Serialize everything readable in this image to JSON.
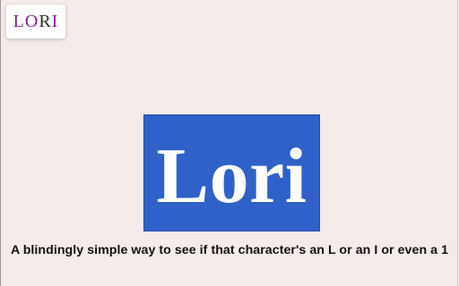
{
  "header": {
    "logo_text_part1": "LO",
    "logo_text_part2": "R",
    "logo_text_part3": "I"
  },
  "hero": {
    "wordmark": "Lori"
  },
  "tagline": "A blindingly simple way to see if that character's an L or an I or even a 1",
  "colors": {
    "page_background": "#f5ebe8",
    "hero_background": "#2f61c9",
    "logo_accent": "#8b1f8f",
    "text": "#111111"
  }
}
